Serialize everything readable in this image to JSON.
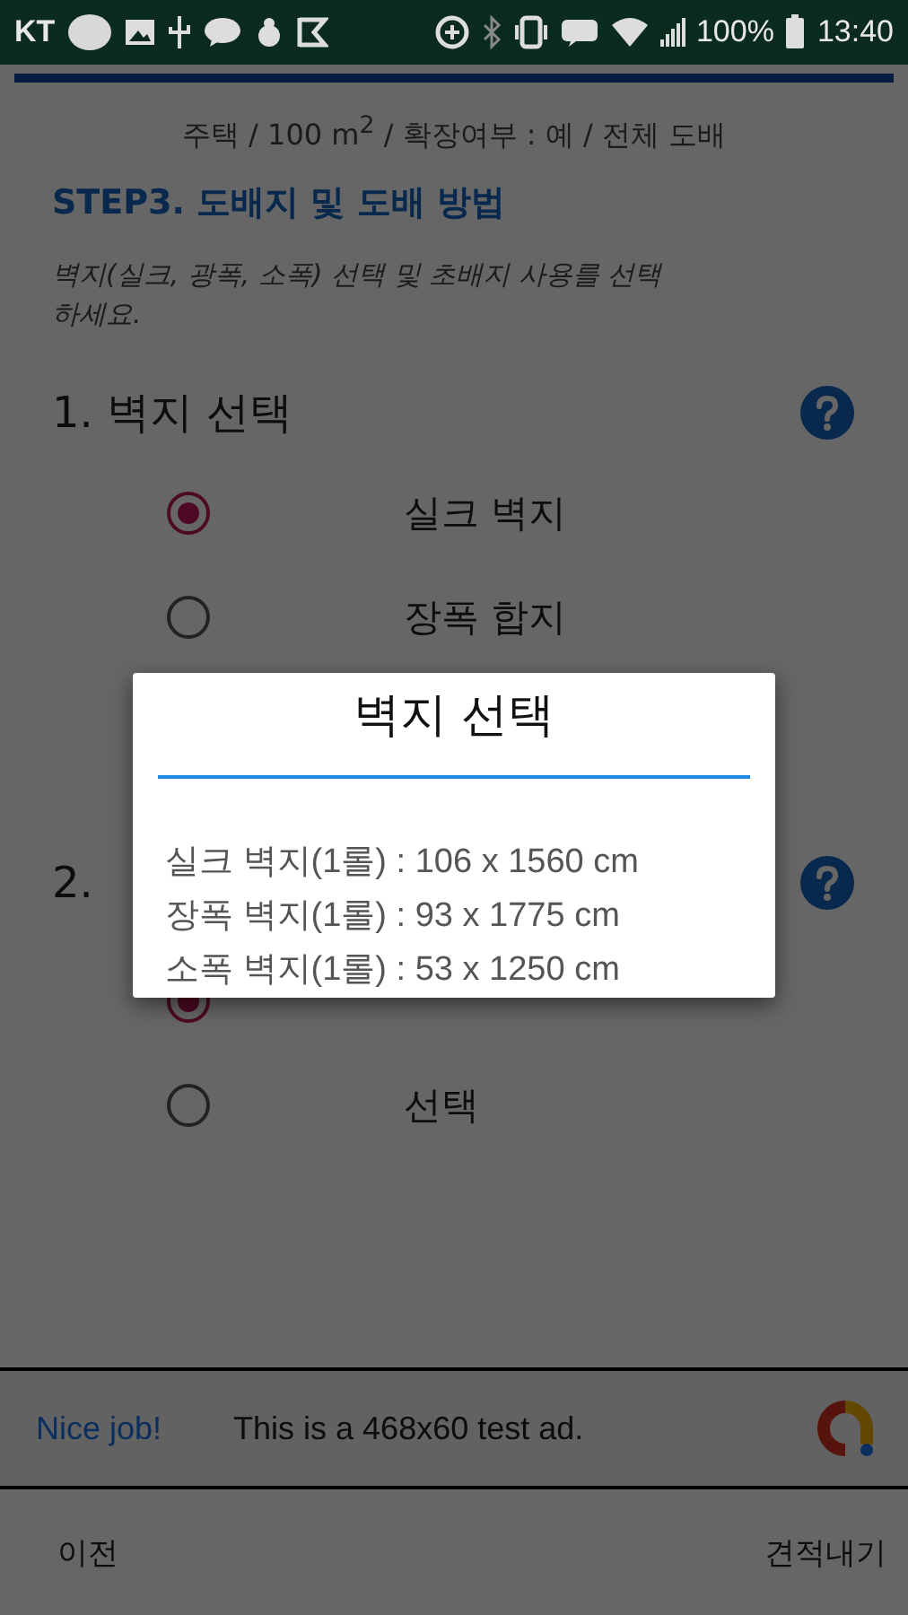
{
  "status_bar": {
    "carrier": "KT",
    "battery": "100%",
    "time": "13:40"
  },
  "summary": "주택 / 100 m$^{2}$ / 확장여부 : 예 / 전체 도배",
  "step_title": "STEP3. 도배지 및 도배 방법",
  "description": "벽지(실크, 광폭, 소폭) 선택 및 초배지 사용를 선택하세요.",
  "sections": [
    {
      "title": "1. 벽지 선택",
      "options": [
        {
          "label": "실크 벽지",
          "selected": true
        },
        {
          "label": "장폭 합지",
          "selected": false
        }
      ]
    },
    {
      "title": "2.",
      "options": [
        {
          "selected": true
        },
        {
          "label": "선택",
          "selected": false
        }
      ]
    }
  ],
  "dialog": {
    "title": "벽지 선택",
    "lines": [
      "실크 벽지(1롤) : 106 x 1560 cm",
      "장폭 벽지(1롤) :  93 x 1775 cm",
      "소폭 벽지(1롤) :  53 x 1250 cm"
    ]
  },
  "ad": {
    "headline": "Nice job!",
    "text": "This is a 468x60 test ad."
  },
  "nav": {
    "prev": "이전",
    "next": "견적내기"
  }
}
